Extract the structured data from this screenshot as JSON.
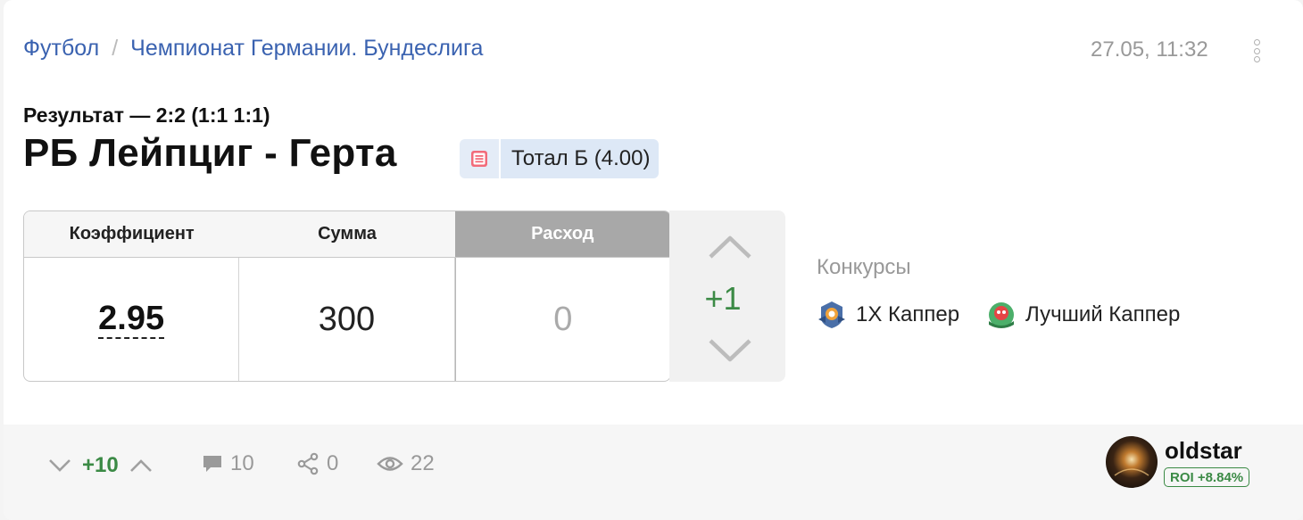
{
  "breadcrumb": {
    "sport": "Футбол",
    "separator": "/",
    "league": "Чемпионат Германии. Бундеслига"
  },
  "datetime": "27.05, 11:32",
  "result": "Результат — 2:2 (1:1 1:1)",
  "match": "РБ Лейпциг - Герта",
  "bet": {
    "icon": "list-icon",
    "label": "Тотал Б (4.00)"
  },
  "stake_table": {
    "headers": {
      "coefficient": "Коэффициент",
      "amount": "Сумма",
      "expense": "Расход"
    },
    "values": {
      "coefficient": "2.95",
      "amount": "300",
      "expense": "0"
    }
  },
  "rating": {
    "score": "+1"
  },
  "contests": {
    "title": "Конкурсы",
    "items": [
      {
        "label": "1X Каппер",
        "icon": "1x-capper-badge-icon"
      },
      {
        "label": "Лучший Каппер",
        "icon": "best-capper-badge-icon"
      }
    ]
  },
  "footer": {
    "votes": "+10",
    "comments": "10",
    "shares": "0",
    "views": "22"
  },
  "author": {
    "username": "oldstar",
    "roi": "ROI +8.84%"
  },
  "colors": {
    "link": "#3a62b0",
    "positive": "#3b8a45",
    "muted": "#999999"
  }
}
